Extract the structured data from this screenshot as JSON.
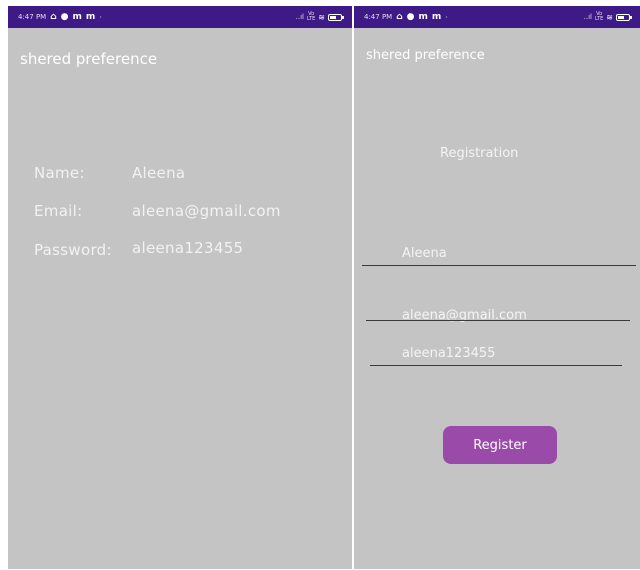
{
  "status_bar": {
    "time": "4:47 PM",
    "icons": [
      "notification-icon",
      "gmail-icon",
      "gmail-icon",
      "gmail-icon"
    ],
    "dot": "·",
    "signal": "..ıl",
    "volte": "Vo\nLTE",
    "background_color": "#3e1a86"
  },
  "left_screen": {
    "app_title": "shered preference",
    "rows": [
      {
        "label": "Name:",
        "value": "Aleena"
      },
      {
        "label": "Email:",
        "value": "aleena@gmail.com"
      },
      {
        "label": "Password:",
        "value": "aleena123455"
      }
    ]
  },
  "right_screen": {
    "app_title": "shered preference",
    "heading": "Registration",
    "name_field": {
      "value": "Aleena"
    },
    "email_field": {
      "value": "aleena@gmail.com"
    },
    "password_field": {
      "value": "aleena123455"
    },
    "register_button": "Register",
    "button_color": "#9a4aa8"
  },
  "colors": {
    "background": "#c4c4c4",
    "text": "#f2f2f2"
  }
}
